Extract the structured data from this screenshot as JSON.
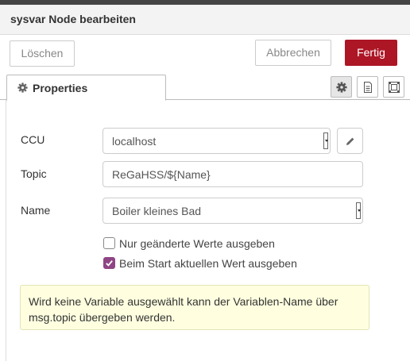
{
  "dialog": {
    "title": "sysvar Node bearbeiten",
    "buttons": {
      "delete_label": "Löschen",
      "cancel_label": "Abbrechen",
      "done_label": "Fertig"
    }
  },
  "tabs": {
    "active_label": "Properties",
    "toolbar_icons": [
      "gear-icon",
      "document-icon",
      "frame-icon"
    ]
  },
  "form": {
    "ccu": {
      "label": "CCU",
      "value": "localhost"
    },
    "topic": {
      "label": "Topic",
      "value": "ReGaHSS/${Name}"
    },
    "name": {
      "label": "Name",
      "value": "Boiler kleines Bad"
    },
    "checkboxes": [
      {
        "label": "Nur geänderte Werte ausgeben",
        "checked": false
      },
      {
        "label": "Beim Start aktuellen Wert ausgeben",
        "checked": true
      }
    ],
    "tip": "Wird keine Variable ausgewählt kann der Variablen-Name über msg.topic übergeben werden."
  },
  "colors": {
    "primary_button": "#ad1625",
    "checkbox_checked": "#8f4585",
    "tip_background": "#ffffe0"
  }
}
